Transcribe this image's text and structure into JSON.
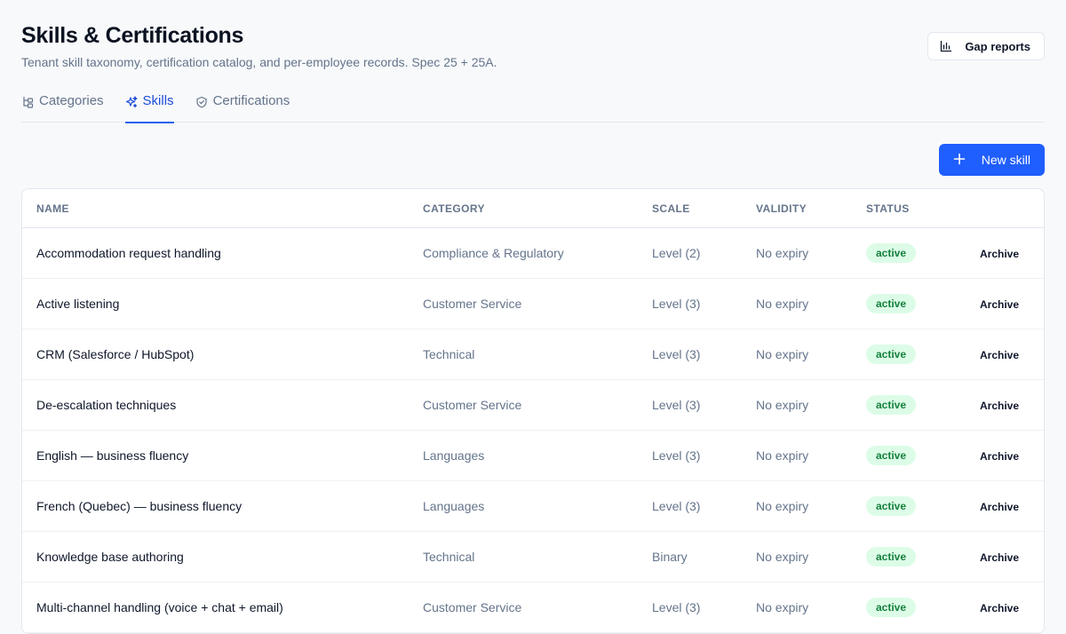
{
  "header": {
    "title": "Skills & Certifications",
    "subtitle": "Tenant skill taxonomy, certification catalog, and per-employee records. Spec 25 + 25A.",
    "gap_reports_label": "Gap reports",
    "gap_reports_icon": "bar-chart-icon"
  },
  "tabs": [
    {
      "label": "Categories",
      "icon": "tree-icon",
      "active": false
    },
    {
      "label": "Skills",
      "icon": "sparkles-icon",
      "active": true
    },
    {
      "label": "Certifications",
      "icon": "shield-check-icon",
      "active": false
    }
  ],
  "toolbar": {
    "new_skill_label": "New skill",
    "new_skill_icon": "plus-icon"
  },
  "table": {
    "columns": {
      "name": "NAME",
      "category": "CATEGORY",
      "scale": "SCALE",
      "validity": "VALIDITY",
      "status": "STATUS"
    },
    "rows": [
      {
        "name": "Accommodation request handling",
        "category": "Compliance & Regulatory",
        "scale": "Level (2)",
        "validity": "No expiry",
        "status": "active",
        "action": "Archive"
      },
      {
        "name": "Active listening",
        "category": "Customer Service",
        "scale": "Level (3)",
        "validity": "No expiry",
        "status": "active",
        "action": "Archive"
      },
      {
        "name": "CRM (Salesforce / HubSpot)",
        "category": "Technical",
        "scale": "Level (3)",
        "validity": "No expiry",
        "status": "active",
        "action": "Archive"
      },
      {
        "name": "De-escalation techniques",
        "category": "Customer Service",
        "scale": "Level (3)",
        "validity": "No expiry",
        "status": "active",
        "action": "Archive"
      },
      {
        "name": "English — business fluency",
        "category": "Languages",
        "scale": "Level (3)",
        "validity": "No expiry",
        "status": "active",
        "action": "Archive"
      },
      {
        "name": "French (Quebec) — business fluency",
        "category": "Languages",
        "scale": "Level (3)",
        "validity": "No expiry",
        "status": "active",
        "action": "Archive"
      },
      {
        "name": "Knowledge base authoring",
        "category": "Technical",
        "scale": "Binary",
        "validity": "No expiry",
        "status": "active",
        "action": "Archive"
      },
      {
        "name": "Multi-channel handling (voice + chat + email)",
        "category": "Customer Service",
        "scale": "Level (3)",
        "validity": "No expiry",
        "status": "active",
        "action": "Archive"
      }
    ]
  },
  "colors": {
    "accent": "#1f5eff",
    "active_tab": "#1d4ed8",
    "badge_bg": "#dcfce7",
    "badge_text": "#15803d"
  }
}
